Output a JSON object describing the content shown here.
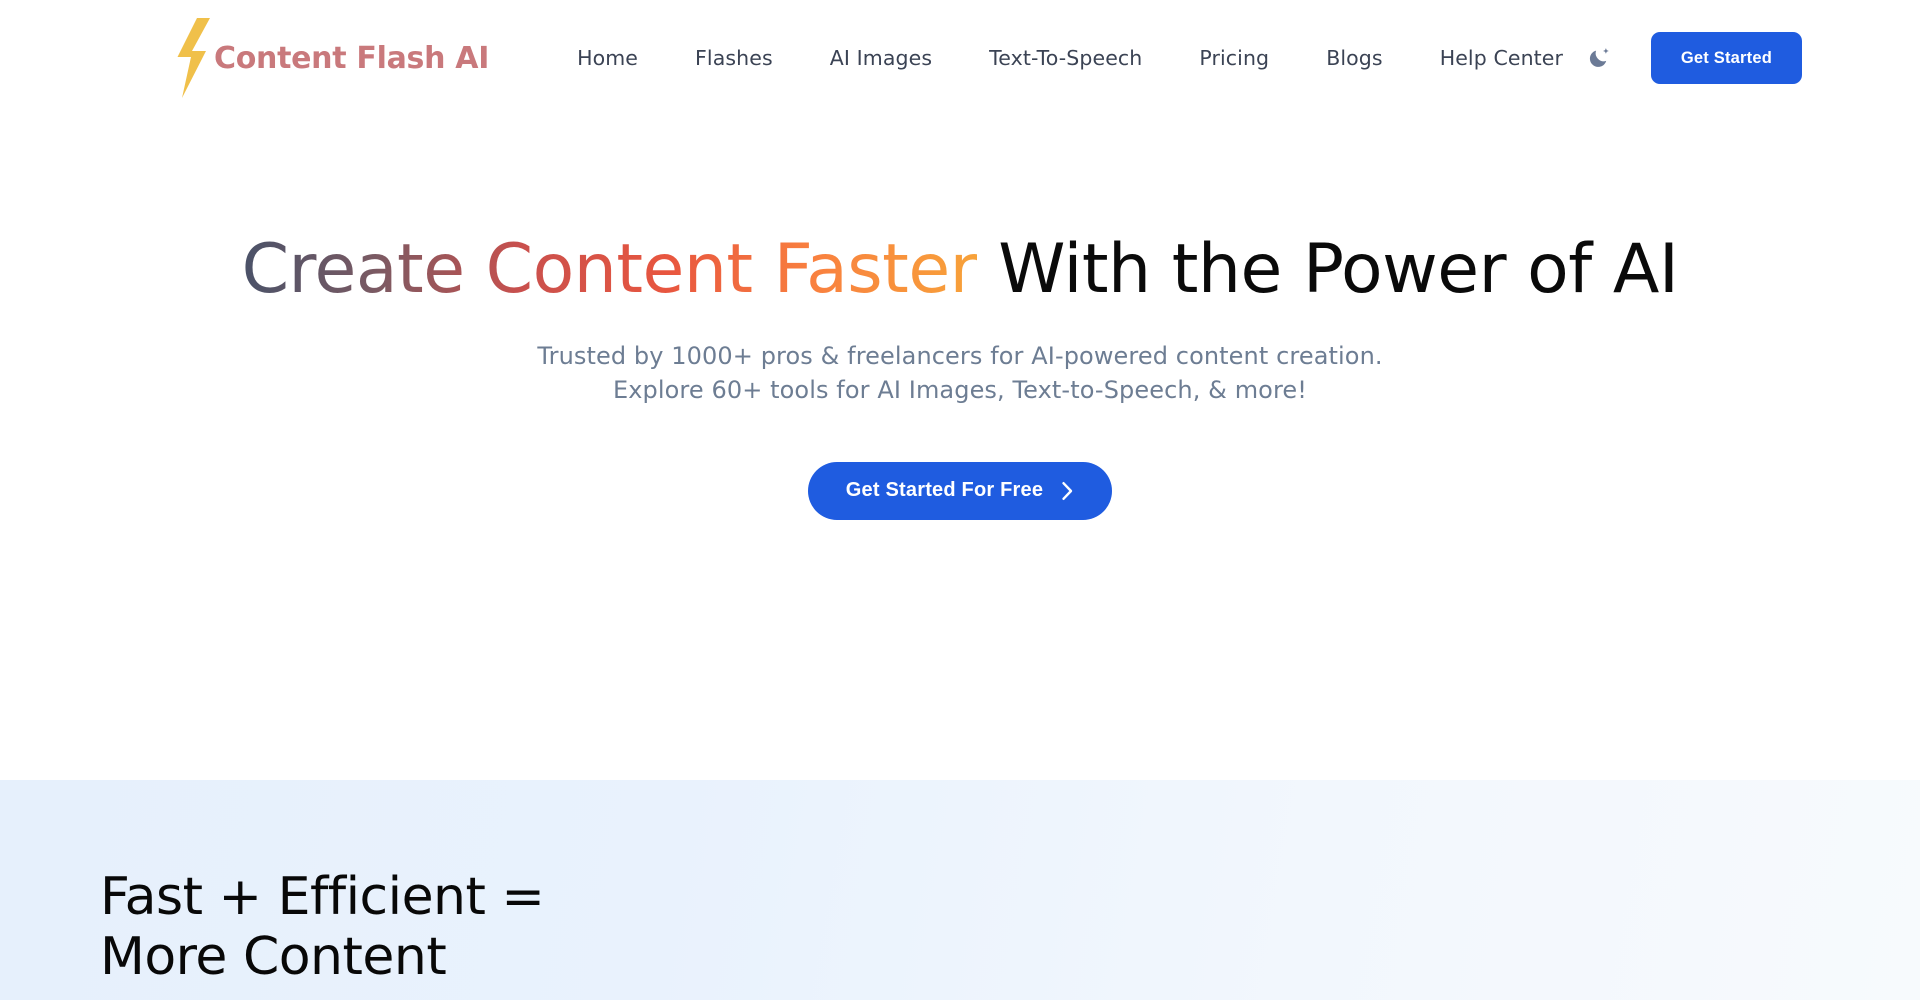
{
  "brand": {
    "name": "Content Flash AI",
    "icon": "lightning-bolt-icon",
    "bolt_color": "#f0c04a",
    "text_color": "#c9797c"
  },
  "header": {
    "nav": [
      {
        "label": "Home"
      },
      {
        "label": "Flashes"
      },
      {
        "label": "AI Images"
      },
      {
        "label": "Text-To-Speech"
      },
      {
        "label": "Pricing"
      },
      {
        "label": "Blogs"
      },
      {
        "label": "Help Center"
      }
    ],
    "theme_toggle": {
      "icon": "moon-sparkle-icon",
      "color": "#6b7a96"
    },
    "cta": {
      "label": "Get Started",
      "bg_color": "#1f5ce0",
      "text_color": "#ffffff"
    }
  },
  "hero": {
    "title": {
      "gradient_part": "Create Content Faster",
      "plain_part": " With the Power of AI",
      "gradient_from": "#4a5268",
      "gradient_mid": "#e8563f",
      "gradient_to": "#f7a23a",
      "plain_color": "#0a0a0a"
    },
    "subtitle_lines": [
      "Trusted by 1000+ pros & freelancers for AI-powered content creation.",
      "Explore 60+ tools for AI Images, Text-to-Speech, & more!"
    ],
    "subtitle_color": "#6d7d93",
    "cta": {
      "label": "Get Started For Free",
      "icon": "chevron-right-icon",
      "bg_color": "#1f5ce0",
      "text_color": "#ffffff"
    }
  },
  "feature_section": {
    "heading": "Fast + Efficient = More Content",
    "bg_from": "#e6f0fc",
    "bg_to": "#f7fafd"
  }
}
